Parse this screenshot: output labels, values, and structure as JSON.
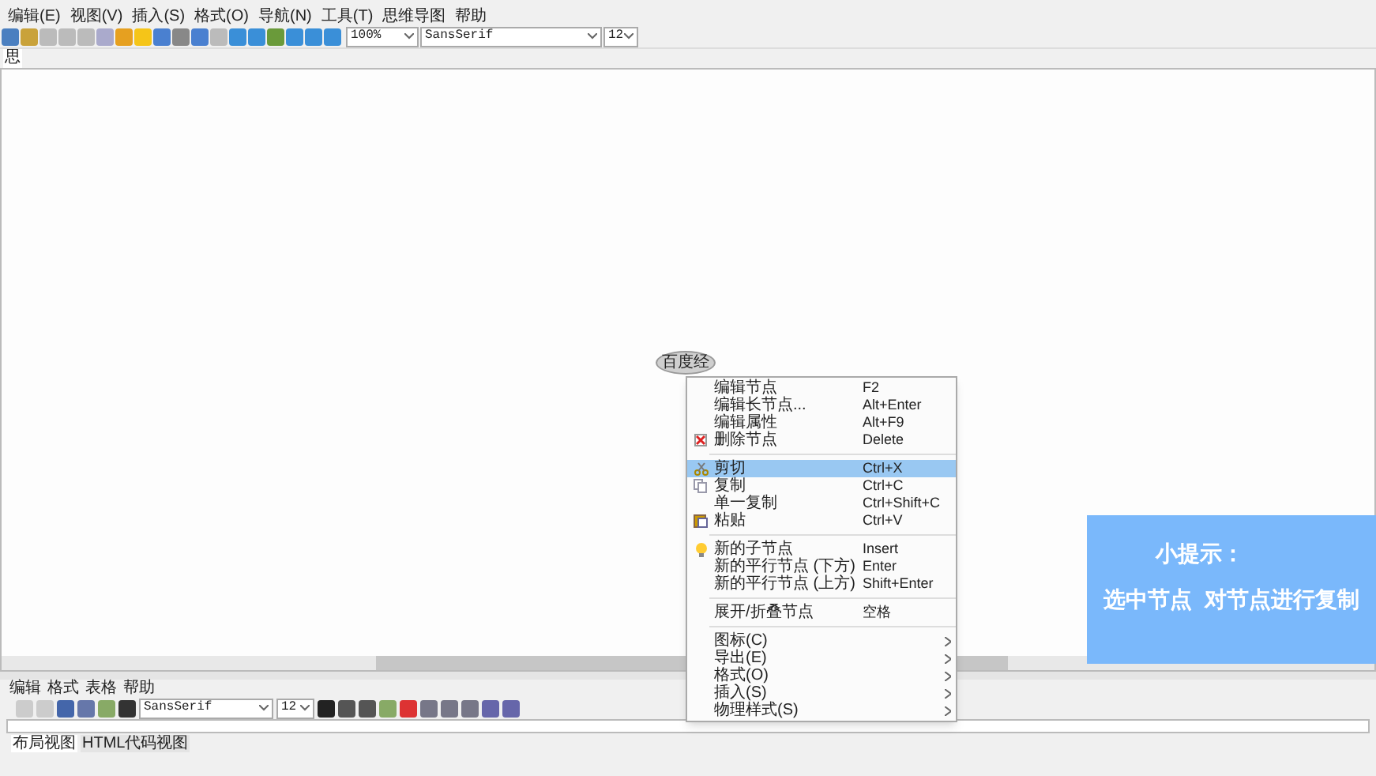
{
  "menubar": [
    "编辑(E)",
    "视图(V)",
    "插入(S)",
    "格式(O)",
    "导航(N)",
    "工具(T)",
    "思维导图",
    "帮助"
  ],
  "toolbar": {
    "zoom": "100%",
    "font": "SansSerif",
    "size": "12"
  },
  "tabs": [
    {
      "label": "思",
      "selected": true
    }
  ],
  "node": {
    "label": "百度经"
  },
  "context_menu": [
    {
      "kind": "plain",
      "label": "编辑节点",
      "shortcut": "F2",
      "selected": false
    },
    {
      "kind": "plain",
      "label": "编辑长节点...",
      "shortcut": "Alt+Enter",
      "selected": false
    },
    {
      "kind": "plain",
      "label": "编辑属性",
      "shortcut": "Alt+F9",
      "selected": false
    },
    {
      "kind": "delete",
      "label": "删除节点",
      "shortcut": "Delete",
      "selected": false
    },
    {
      "kind": "separator"
    },
    {
      "kind": "cut",
      "label": "剪切",
      "shortcut": "Ctrl+X",
      "selected": true
    },
    {
      "kind": "copy",
      "label": "复制",
      "shortcut": "Ctrl+C",
      "selected": false
    },
    {
      "kind": "plain",
      "label": "单一复制",
      "shortcut": "Ctrl+Shift+C",
      "selected": false
    },
    {
      "kind": "paste",
      "label": "粘贴",
      "shortcut": "Ctrl+V",
      "selected": false
    },
    {
      "kind": "separator"
    },
    {
      "kind": "bulb",
      "label": "新的子节点",
      "shortcut": "Insert",
      "selected": false
    },
    {
      "kind": "plain",
      "label": "新的平行节点 (下方)",
      "shortcut": "Enter",
      "selected": false
    },
    {
      "kind": "plain",
      "label": "新的平行节点 (上方)",
      "shortcut": "Shift+Enter",
      "selected": false
    },
    {
      "kind": "separator"
    },
    {
      "kind": "plain",
      "label": "展开/折叠节点",
      "shortcut": "空格",
      "selected": false
    },
    {
      "kind": "separator"
    },
    {
      "kind": "submenu",
      "label": "图标(C)",
      "selected": false
    },
    {
      "kind": "submenu",
      "label": "导出(E)",
      "selected": false
    },
    {
      "kind": "submenu",
      "label": "格式(O)",
      "selected": false
    },
    {
      "kind": "submenu",
      "label": "插入(S)",
      "selected": false
    },
    {
      "kind": "submenu",
      "label": "物理样式(S)",
      "selected": false
    }
  ],
  "tip": {
    "title": "小提示：",
    "text": "选中节点  对节点进行复制"
  },
  "editor": {
    "menubar": [
      "编辑",
      "格式",
      "表格",
      "帮助"
    ],
    "font": "SansSerif",
    "size": "12",
    "tabs": [
      {
        "label": "布局视图",
        "selected": true
      },
      {
        "label": "HTML代码视图",
        "selected": false
      }
    ]
  }
}
